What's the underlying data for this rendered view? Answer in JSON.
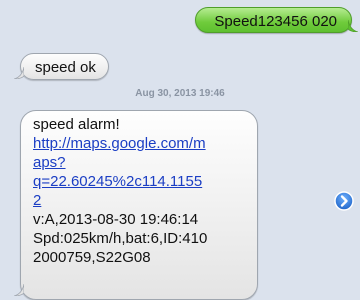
{
  "messages": {
    "sent": {
      "text": "Speed123456 020"
    },
    "received_1": {
      "text": "speed ok"
    },
    "timestamp": "Aug 30, 2013 19:46",
    "received_2": {
      "line1": "speed alarm!",
      "link_lines": [
        "http://maps.google.com/m",
        "aps?",
        "q=22.60245%2c114.1155",
        "2"
      ],
      "line_v": "v:A,2013-08-30 19:46:14",
      "line_spd": "Spd:025km/h,bat:6,ID:410",
      "line_id": "2000759,S22G08"
    }
  },
  "icons": {
    "forward": "chevron-right-circle-icon"
  },
  "colors": {
    "sent_bubble": "#6fcb3b",
    "received_bubble": "#eeeeee",
    "background": "#dbe2ed",
    "link": "#1b3ec4",
    "forward_icon": "#2f7ee0"
  }
}
